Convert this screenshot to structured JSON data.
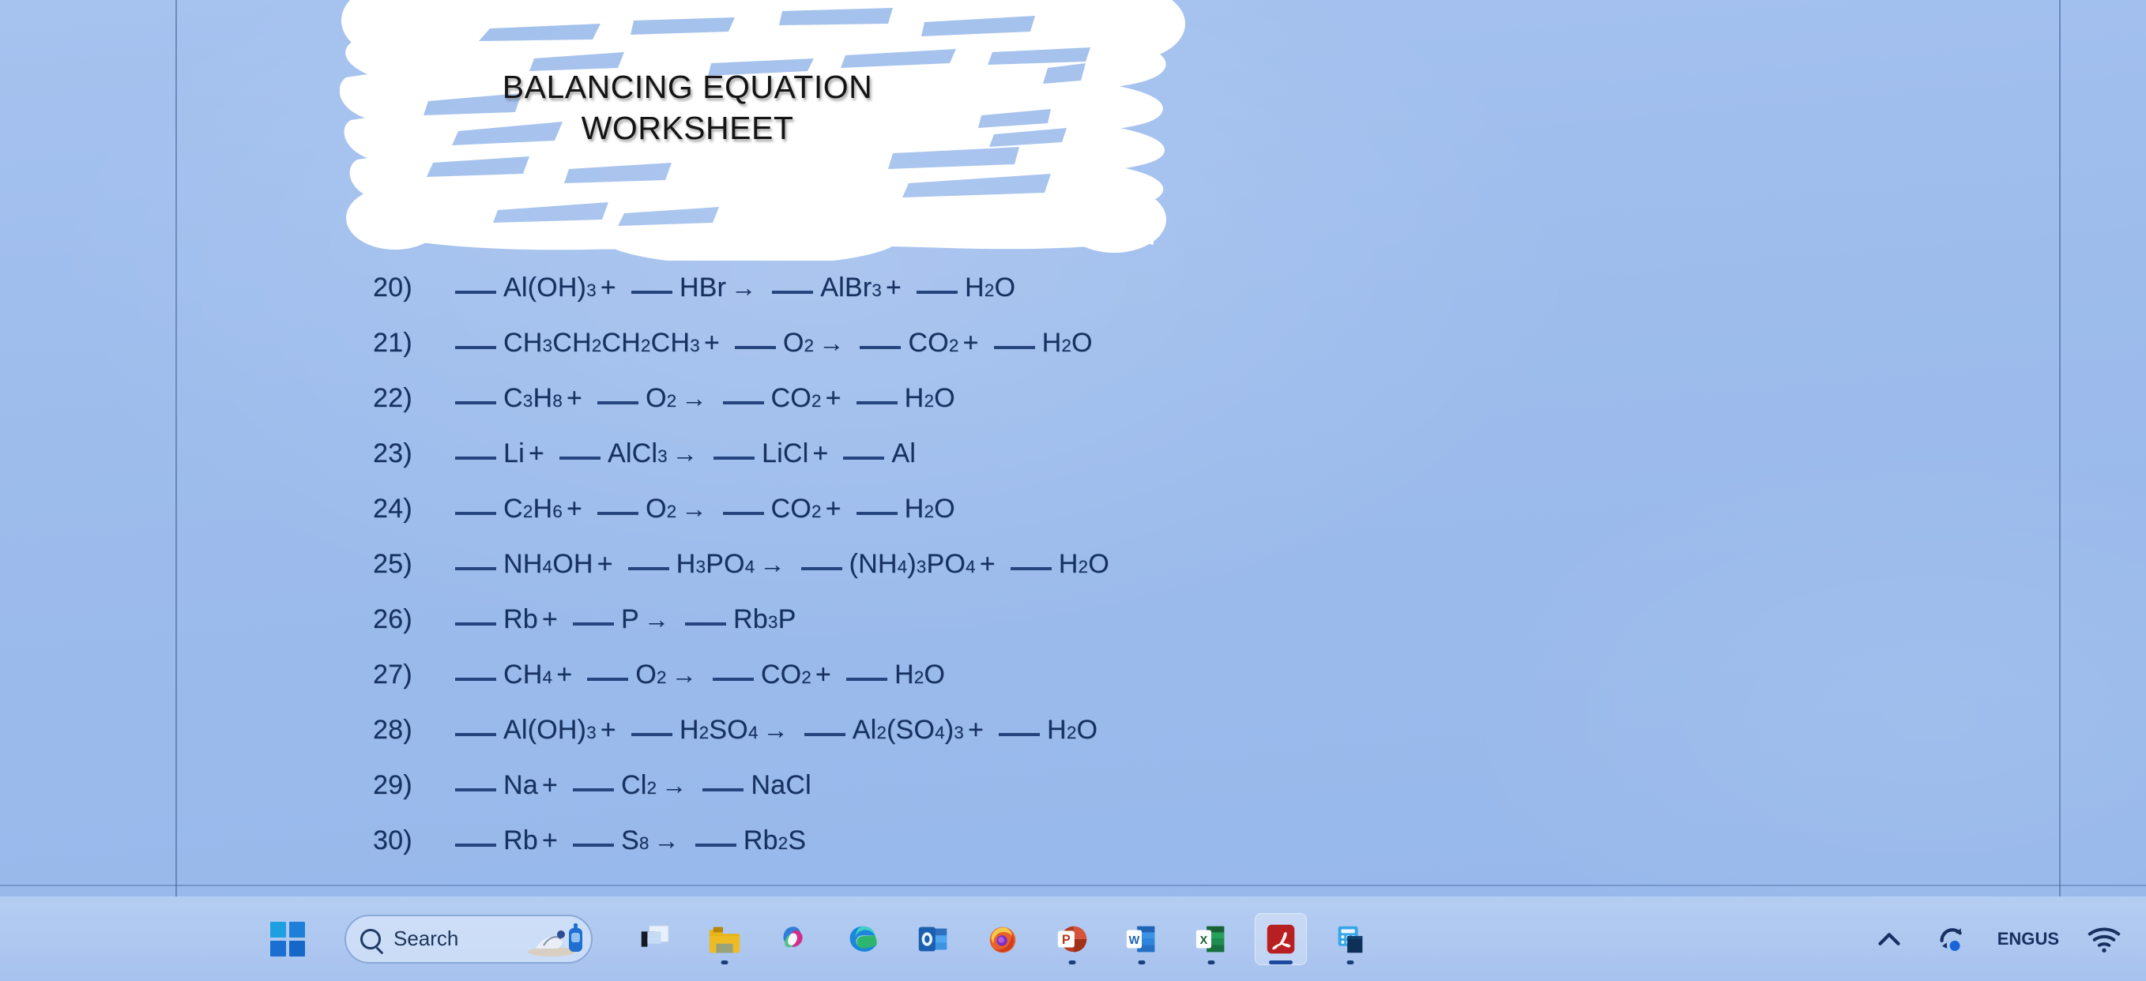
{
  "document": {
    "title_line1": "BALANCING EQUATION",
    "title_line2": "WORKSHEET",
    "equations": [
      {
        "num": "20)",
        "parts": [
          {
            "t": "blank"
          },
          {
            "t": "txt",
            "v": "Al(OH)"
          },
          {
            "t": "sub",
            "v": "3"
          },
          {
            "t": "op",
            "v": "+"
          },
          {
            "t": "blank"
          },
          {
            "t": "txt",
            "v": "HBr"
          },
          {
            "t": "arrow",
            "v": "→"
          },
          {
            "t": "blank"
          },
          {
            "t": "txt",
            "v": "AlBr"
          },
          {
            "t": "sub",
            "v": "3"
          },
          {
            "t": "op",
            "v": "+"
          },
          {
            "t": "blank"
          },
          {
            "t": "txt",
            "v": "H"
          },
          {
            "t": "sub",
            "v": "2"
          },
          {
            "t": "txt",
            "v": "O"
          }
        ]
      },
      {
        "num": "21)",
        "parts": [
          {
            "t": "blank"
          },
          {
            "t": "txt",
            "v": "CH"
          },
          {
            "t": "sub",
            "v": "3"
          },
          {
            "t": "txt",
            "v": "CH"
          },
          {
            "t": "sub",
            "v": "2"
          },
          {
            "t": "txt",
            "v": "CH"
          },
          {
            "t": "sub",
            "v": "2"
          },
          {
            "t": "txt",
            "v": "CH"
          },
          {
            "t": "sub",
            "v": "3"
          },
          {
            "t": "op",
            "v": "+"
          },
          {
            "t": "blank"
          },
          {
            "t": "txt",
            "v": "O"
          },
          {
            "t": "sub",
            "v": "2"
          },
          {
            "t": "arrow",
            "v": "→"
          },
          {
            "t": "blank"
          },
          {
            "t": "txt",
            "v": "CO"
          },
          {
            "t": "sub",
            "v": "2"
          },
          {
            "t": "op",
            "v": "+"
          },
          {
            "t": "blank"
          },
          {
            "t": "txt",
            "v": "H"
          },
          {
            "t": "sub",
            "v": "2"
          },
          {
            "t": "txt",
            "v": "O"
          }
        ]
      },
      {
        "num": "22)",
        "parts": [
          {
            "t": "blank"
          },
          {
            "t": "txt",
            "v": "C"
          },
          {
            "t": "sub",
            "v": "3"
          },
          {
            "t": "txt",
            "v": "H"
          },
          {
            "t": "sub",
            "v": "8"
          },
          {
            "t": "op",
            "v": "+"
          },
          {
            "t": "blank"
          },
          {
            "t": "txt",
            "v": "O"
          },
          {
            "t": "sub",
            "v": "2"
          },
          {
            "t": "arrow",
            "v": "→"
          },
          {
            "t": "blank"
          },
          {
            "t": "txt",
            "v": "CO"
          },
          {
            "t": "sub",
            "v": "2"
          },
          {
            "t": "op",
            "v": "+"
          },
          {
            "t": "blank"
          },
          {
            "t": "txt",
            "v": "H"
          },
          {
            "t": "sub",
            "v": "2"
          },
          {
            "t": "txt",
            "v": "O"
          }
        ]
      },
      {
        "num": "23)",
        "parts": [
          {
            "t": "blank"
          },
          {
            "t": "txt",
            "v": "Li"
          },
          {
            "t": "op",
            "v": "+"
          },
          {
            "t": "blank"
          },
          {
            "t": "txt",
            "v": "AlCl"
          },
          {
            "t": "sub",
            "v": "3"
          },
          {
            "t": "arrow",
            "v": "→"
          },
          {
            "t": "blank"
          },
          {
            "t": "txt",
            "v": "LiCl"
          },
          {
            "t": "op",
            "v": "+"
          },
          {
            "t": "blank"
          },
          {
            "t": "txt",
            "v": "Al"
          }
        ]
      },
      {
        "num": "24)",
        "parts": [
          {
            "t": "blank"
          },
          {
            "t": "txt",
            "v": "C"
          },
          {
            "t": "sub",
            "v": "2"
          },
          {
            "t": "txt",
            "v": "H"
          },
          {
            "t": "sub",
            "v": "6"
          },
          {
            "t": "op",
            "v": "+"
          },
          {
            "t": "blank"
          },
          {
            "t": "txt",
            "v": "O"
          },
          {
            "t": "sub",
            "v": "2"
          },
          {
            "t": "arrow",
            "v": "→"
          },
          {
            "t": "blank"
          },
          {
            "t": "txt",
            "v": "CO"
          },
          {
            "t": "sub",
            "v": "2"
          },
          {
            "t": "op",
            "v": "+"
          },
          {
            "t": "blank"
          },
          {
            "t": "txt",
            "v": "H"
          },
          {
            "t": "sub",
            "v": "2"
          },
          {
            "t": "txt",
            "v": "O"
          }
        ]
      },
      {
        "num": "25)",
        "parts": [
          {
            "t": "blank"
          },
          {
            "t": "txt",
            "v": "NH"
          },
          {
            "t": "sub",
            "v": "4"
          },
          {
            "t": "txt",
            "v": "OH"
          },
          {
            "t": "op",
            "v": "+"
          },
          {
            "t": "blank"
          },
          {
            "t": "txt",
            "v": "H"
          },
          {
            "t": "sub",
            "v": "3"
          },
          {
            "t": "txt",
            "v": "PO"
          },
          {
            "t": "sub",
            "v": "4"
          },
          {
            "t": "arrow",
            "v": "→"
          },
          {
            "t": "blank"
          },
          {
            "t": "txt",
            "v": "(NH"
          },
          {
            "t": "sub",
            "v": "4"
          },
          {
            "t": "txt",
            "v": ")"
          },
          {
            "t": "sub",
            "v": "3"
          },
          {
            "t": "txt",
            "v": "PO"
          },
          {
            "t": "sub",
            "v": "4"
          },
          {
            "t": "op",
            "v": "+"
          },
          {
            "t": "blank"
          },
          {
            "t": "txt",
            "v": "H"
          },
          {
            "t": "sub",
            "v": "2"
          },
          {
            "t": "txt",
            "v": "O"
          }
        ]
      },
      {
        "num": "26)",
        "parts": [
          {
            "t": "blank"
          },
          {
            "t": "txt",
            "v": "Rb"
          },
          {
            "t": "op",
            "v": "+"
          },
          {
            "t": "blank"
          },
          {
            "t": "txt",
            "v": "P"
          },
          {
            "t": "arrow",
            "v": "→"
          },
          {
            "t": "blank"
          },
          {
            "t": "txt",
            "v": "Rb"
          },
          {
            "t": "sub",
            "v": "3"
          },
          {
            "t": "txt",
            "v": "P"
          }
        ]
      },
      {
        "num": "27)",
        "parts": [
          {
            "t": "blank"
          },
          {
            "t": "txt",
            "v": "CH"
          },
          {
            "t": "sub",
            "v": "4"
          },
          {
            "t": "op",
            "v": "+"
          },
          {
            "t": "blank"
          },
          {
            "t": "txt",
            "v": "O"
          },
          {
            "t": "sub",
            "v": "2"
          },
          {
            "t": "arrow",
            "v": "→"
          },
          {
            "t": "blank"
          },
          {
            "t": "txt",
            "v": "CO"
          },
          {
            "t": "sub",
            "v": "2"
          },
          {
            "t": "op",
            "v": "+"
          },
          {
            "t": "blank"
          },
          {
            "t": "txt",
            "v": "H"
          },
          {
            "t": "sub",
            "v": "2"
          },
          {
            "t": "txt",
            "v": "O"
          }
        ]
      },
      {
        "num": "28)",
        "parts": [
          {
            "t": "blank"
          },
          {
            "t": "txt",
            "v": "Al(OH)"
          },
          {
            "t": "sub",
            "v": "3"
          },
          {
            "t": "op",
            "v": "+"
          },
          {
            "t": "blank"
          },
          {
            "t": "txt",
            "v": "H"
          },
          {
            "t": "sub",
            "v": "2"
          },
          {
            "t": "txt",
            "v": "SO"
          },
          {
            "t": "sub",
            "v": "4"
          },
          {
            "t": "arrow",
            "v": "→"
          },
          {
            "t": "blank"
          },
          {
            "t": "txt",
            "v": "Al"
          },
          {
            "t": "sub",
            "v": "2"
          },
          {
            "t": "txt",
            "v": "(SO"
          },
          {
            "t": "sub",
            "v": "4"
          },
          {
            "t": "txt",
            "v": ")"
          },
          {
            "t": "sub",
            "v": "3"
          },
          {
            "t": "op",
            "v": "+"
          },
          {
            "t": "blank"
          },
          {
            "t": "txt",
            "v": "H"
          },
          {
            "t": "sub",
            "v": "2"
          },
          {
            "t": "txt",
            "v": "O"
          }
        ]
      },
      {
        "num": "29)",
        "parts": [
          {
            "t": "blank"
          },
          {
            "t": "txt",
            "v": "Na"
          },
          {
            "t": "op",
            "v": "+"
          },
          {
            "t": "blank"
          },
          {
            "t": "txt",
            "v": "Cl"
          },
          {
            "t": "sub",
            "v": "2"
          },
          {
            "t": "arrow",
            "v": "→"
          },
          {
            "t": "blank"
          },
          {
            "t": "txt",
            "v": "NaCl"
          }
        ]
      },
      {
        "num": "30)",
        "parts": [
          {
            "t": "blank"
          },
          {
            "t": "txt",
            "v": "Rb"
          },
          {
            "t": "op",
            "v": "+"
          },
          {
            "t": "blank"
          },
          {
            "t": "txt",
            "v": "S"
          },
          {
            "t": "sub",
            "v": "8"
          },
          {
            "t": "arrow",
            "v": "→"
          },
          {
            "t": "blank"
          },
          {
            "t": "txt",
            "v": "Rb"
          },
          {
            "t": "sub",
            "v": "2"
          },
          {
            "t": "txt",
            "v": "S"
          }
        ]
      }
    ]
  },
  "taskbar": {
    "start_label": "Start",
    "search": {
      "placeholder": "Search",
      "icon": "search-icon"
    },
    "apps": [
      {
        "name": "task-view",
        "label": "Task View",
        "active": false,
        "running": false
      },
      {
        "name": "file-explorer",
        "label": "File Explorer",
        "active": false,
        "running": true
      },
      {
        "name": "copilot",
        "label": "Copilot",
        "active": false,
        "running": false
      },
      {
        "name": "microsoft-edge",
        "label": "Microsoft Edge",
        "active": false,
        "running": false
      },
      {
        "name": "outlook",
        "label": "Outlook",
        "active": false,
        "running": false
      },
      {
        "name": "firefox",
        "label": "Firefox",
        "active": false,
        "running": false
      },
      {
        "name": "powerpoint",
        "label": "PowerPoint",
        "active": false,
        "running": true
      },
      {
        "name": "word",
        "label": "Word",
        "active": false,
        "running": true
      },
      {
        "name": "excel",
        "label": "Excel",
        "active": false,
        "running": true
      },
      {
        "name": "adobe-acrobat",
        "label": "Adobe Acrobat",
        "active": true,
        "running": true
      },
      {
        "name": "calculator",
        "label": "Calculator",
        "active": false,
        "running": true
      }
    ],
    "tray": {
      "overflow_icon": "chevron-up-icon",
      "onedrive_icon": "onedrive-sync-icon",
      "language_line1": "ENG",
      "language_line2": "US",
      "network_icon": "wifi-icon"
    }
  },
  "colors": {
    "page_background": "#9dbcec",
    "taskbar_background": "#b5cdf2",
    "equation_text": "#16315f",
    "title_text": "#141414",
    "whiteout": "#ffffff"
  }
}
